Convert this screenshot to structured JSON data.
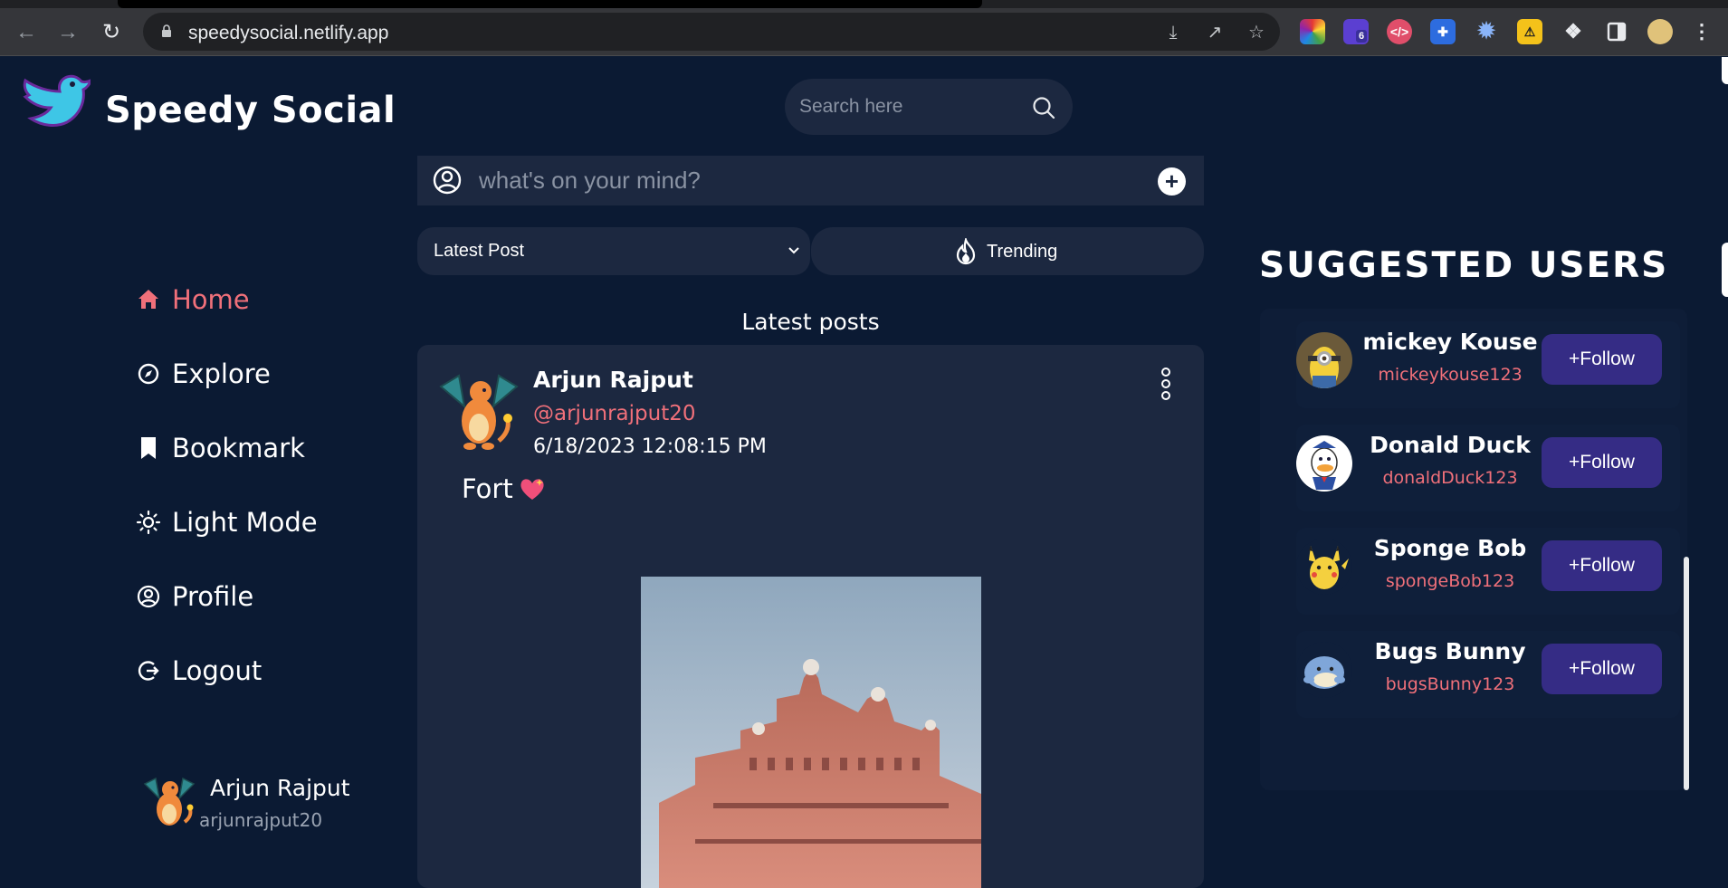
{
  "browser": {
    "url": "speedysocial.netlify.app",
    "extension_badge": "6"
  },
  "app": {
    "brand": "Speedy Social",
    "search_placeholder": "Search here"
  },
  "sidebar": {
    "items": [
      {
        "label": "Home",
        "icon": "home-icon",
        "active": true
      },
      {
        "label": "Explore",
        "icon": "compass-icon",
        "active": false
      },
      {
        "label": "Bookmark",
        "icon": "bookmark-icon",
        "active": false
      },
      {
        "label": "Light Mode",
        "icon": "sun-icon",
        "active": false
      },
      {
        "label": "Profile",
        "icon": "user-circle-icon",
        "active": false
      },
      {
        "label": "Logout",
        "icon": "logout-icon",
        "active": false
      }
    ],
    "user": {
      "name": "Arjun Rajput",
      "handle": "arjunrajput20"
    }
  },
  "composer": {
    "placeholder": "what's on your mind?"
  },
  "filters": {
    "sort_value": "Latest Post",
    "trending_label": "Trending"
  },
  "feed": {
    "title": "Latest posts",
    "posts": [
      {
        "name": "Arjun Rajput",
        "handle": "@arjunrajput20",
        "timestamp": "6/18/2023 12:08:15 PM",
        "text": "Fort"
      }
    ]
  },
  "suggested": {
    "title": "SUGGESTED USERS",
    "follow_label": "+Follow",
    "users": [
      {
        "name": "mickey Kouse",
        "handle": "mickeykouse123"
      },
      {
        "name": "Donald Duck",
        "handle": "donaldDuck123"
      },
      {
        "name": "Sponge Bob",
        "handle": "spongeBob123"
      },
      {
        "name": "Bugs Bunny",
        "handle": "bugsBunny123"
      }
    ]
  },
  "colors": {
    "background": "#0b1a33",
    "card": "#1c2840",
    "accent_pink": "#f0707a",
    "follow_button": "#352c85"
  }
}
